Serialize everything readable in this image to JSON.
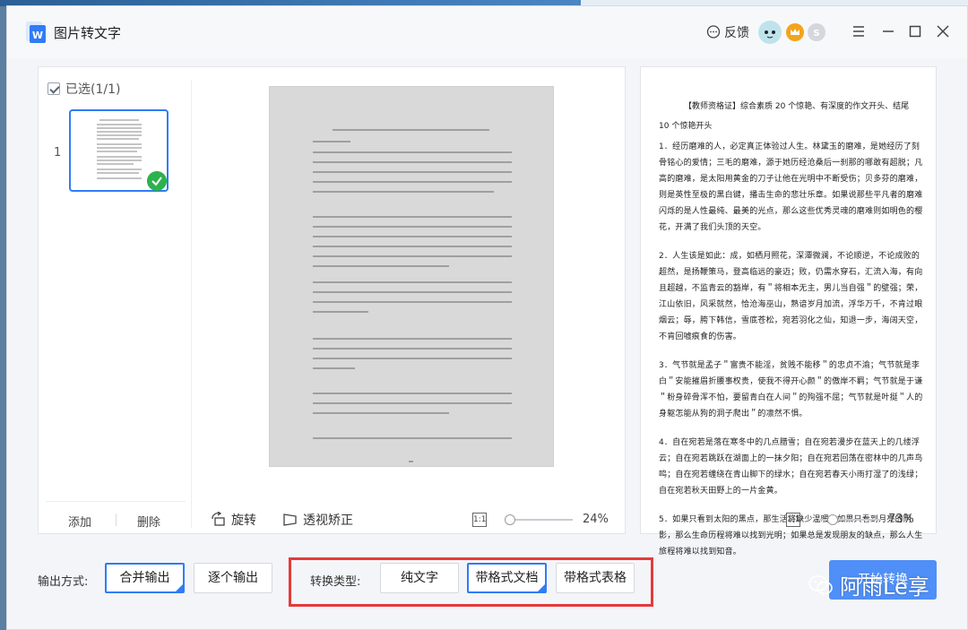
{
  "app": {
    "title": "图片转文字",
    "feedback_label": "反馈"
  },
  "left_panel": {
    "select_all_label": "已选(1/1)",
    "thumbnail_index": "1",
    "add_label": "添加",
    "delete_label": "删除"
  },
  "preview": {
    "rotate_label": "旋转",
    "perspective_label": "透视矫正",
    "zoom": "24%"
  },
  "result": {
    "title": "【教师资格证】综合素质 20 个惊艳、有深度的作文开头、结尾",
    "subtitle": "10 个惊艳开头",
    "paragraphs": [
      "1．经历磨难的人，必定真正体验过人生。林黛玉的磨难，是她经历了刻骨铭心的爱情；三毛的磨难，源于她历经沧桑后一刹那的哪敢有超脱；凡高的磨难，是太阳用黄金的刀子让他在光明中不断受伤；贝多芬的磨难，则是英性至极的黑白键，播击生命的悲壮乐章。如果说那些平凡者的磨难闪烁的是人性最纯、最美的光点，那么这些优秀灵魂的磨难则如明色的樱花，开满了我们头顶的天空。",
      "2．人生该是如此：成，如栖月照花，深潭微澜，不论顺逆，不论成败的超然，是扬鞭策马，登高临远的豪迈；败，仍需水穿石，汇流入海，有向且超越，不监青云的豁岸，有＂将相本无主，男儿当自强＂的壁强；荣，江山依旧，风采就然，恰沧海巫山，熟谙岁月加流，浮华万千，不肯过眼烟云；辱，胯下韩信，雪底苍松，宛若羽化之仙，知退一步，海阔天空，不肯回嘘痕食的伤害。",
      "3．气节就是孟子＂富贵不能淫，贫贱不能移＂的忠贞不渝；气节就是李白＂安能摧眉折腰事权贵，使我不得开心颜＂的傲岸不羁；气节就是于谦＂粉身碎骨浑不怕，要留青白在人间＂的殉强不屈；气节就是叶挺＂人的身躯怎能从狗的洞子爬出＂的凛然不惧。",
      "4．自在宛若是落在寒冬中的几点腊雪；自在宛若漫步在蓝天上的几缕浮云；自在宛若跳跃在湖面上的一抹夕阳；自在宛若回荡在密林中的几声鸟鸣；自在宛若缠绕在青山脚下的绿水；自在宛若春天小雨打湿了的浅绿；自在宛若秋天田野上的一片金黄。",
      "5．如果只看到太阳的黑点，那生活将缺少温暖；如果只看到月亮的阴影，那么生命历程将难以找到光明；如果总是发现朋友的缺点，那么人生旅程将难以找到知音。"
    ],
    "zoom": "73%"
  },
  "bottom": {
    "output_label": "输出方式:",
    "merge_label": "合并输出",
    "each_label": "逐个输出",
    "convert_label": "转换类型:",
    "plain_text_label": "纯文字",
    "format_doc_label": "带格式文档",
    "format_table_label": "带格式表格",
    "start_label": "开始转换"
  },
  "watermark": {
    "text": "阿雨Le享"
  },
  "colors": {
    "accent": "#2f7cf6",
    "highlight_box": "#e53a3a",
    "start_button": "#4f8ff7",
    "check_green": "#2cb24c"
  }
}
